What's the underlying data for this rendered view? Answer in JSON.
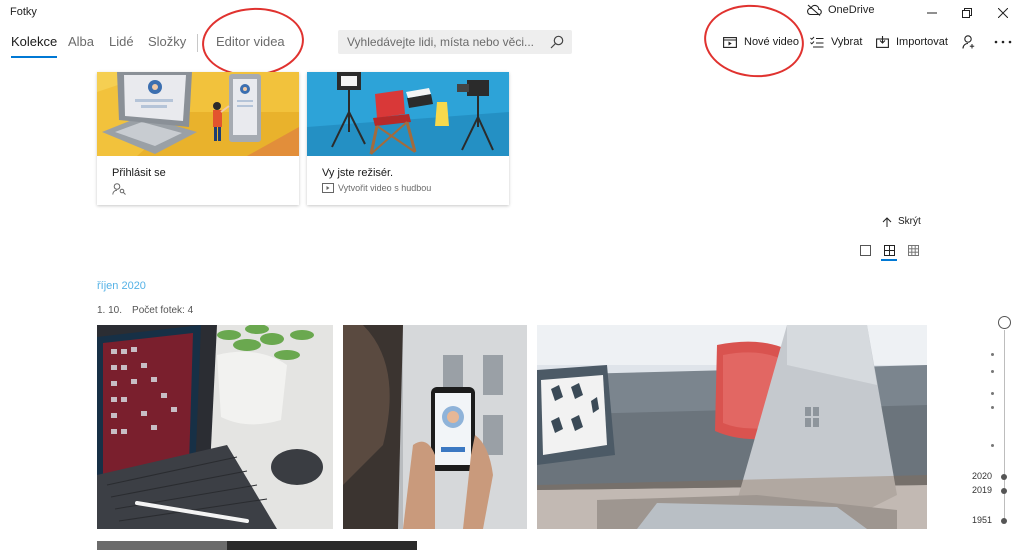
{
  "app": {
    "title": "Fotky"
  },
  "titlebar": {
    "onedrive_label": "OneDrive"
  },
  "nav": {
    "tabs": [
      {
        "label": "Kolekce",
        "active": true
      },
      {
        "label": "Alba"
      },
      {
        "label": "Lidé"
      },
      {
        "label": "Složky"
      },
      {
        "label": "Editor videa"
      }
    ]
  },
  "search": {
    "placeholder": "Vyhledávejte lidi, místa nebo věci..."
  },
  "toolbar": {
    "new_video": "Nové video",
    "select": "Vybrat",
    "import": "Importovat"
  },
  "cards": [
    {
      "title": "Přihlásit se"
    },
    {
      "title": "Vy jste režisér.",
      "subtitle": "Vytvořit video s hudbou"
    }
  ],
  "hide_label": "Skrýt",
  "gallery": {
    "month": "říjen 2020",
    "date": "1. 10.",
    "count": "Počet fotek: 4"
  },
  "timeline": {
    "years": [
      "2020",
      "2019",
      "1951"
    ]
  },
  "colors": {
    "accent": "#0078d4",
    "annotation": "#e0322f",
    "month_text": "#55b2e6"
  }
}
